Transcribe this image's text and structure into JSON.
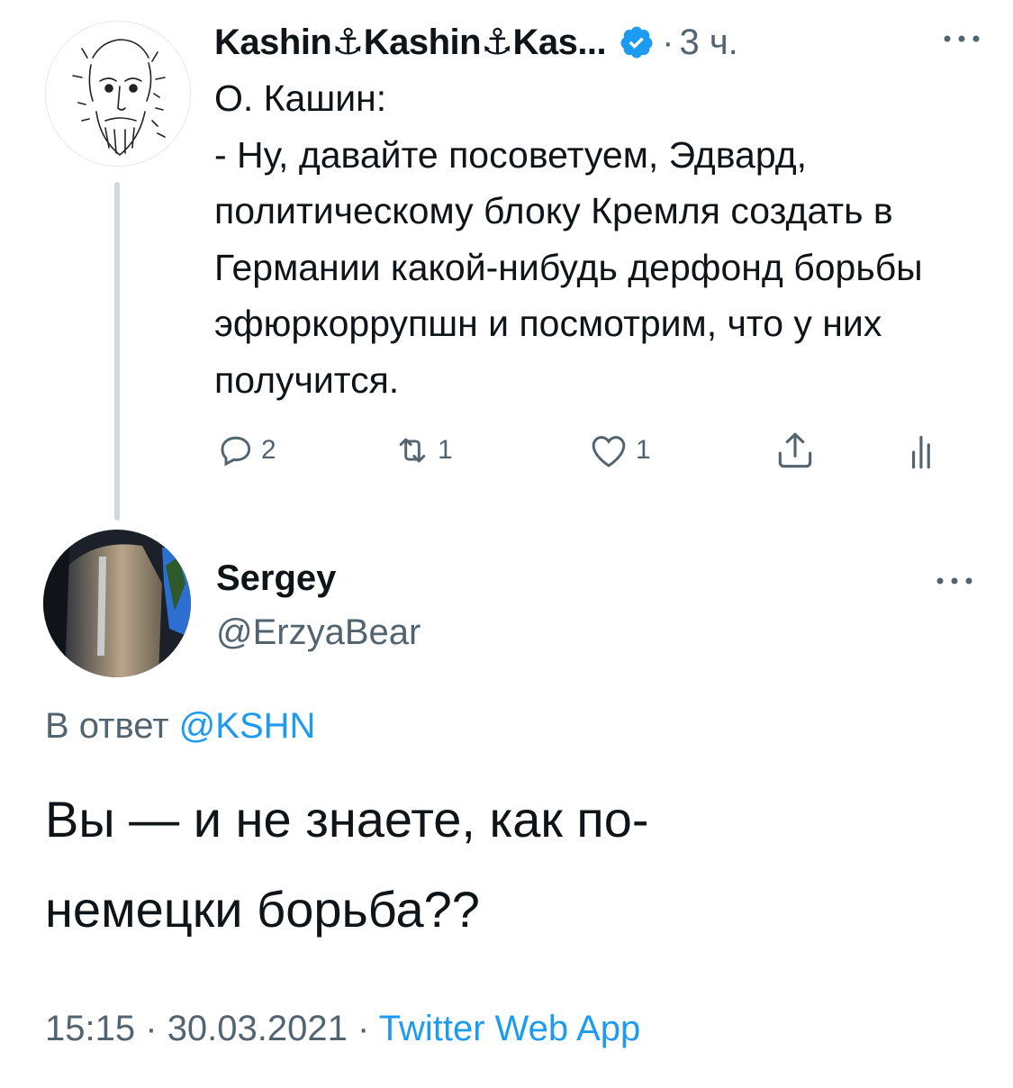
{
  "parent_tweet": {
    "author_name": "Kashin⚓Kashin⚓Kas...",
    "verified": true,
    "separator": "·",
    "time_ago": "3 ч.",
    "text": "О. Кашин:\n- Ну, давайте посоветуем, Эдвард, политическому блоку Кремля создать в Германии какой-нибудь дерфонд борьбы эфюркоррупшн и посмотрим, что у них получится.",
    "actions": {
      "replies": "2",
      "retweets": "1",
      "likes": "1"
    }
  },
  "reply_tweet": {
    "author_name": "Sergey",
    "handle": "@ErzyaBear",
    "reply_label": "В ответ",
    "reply_mention": "@KSHN",
    "text": "Вы — и не знаете, как по-\nнемецки борьба??",
    "time": "15:15",
    "date": "30.03.2021",
    "source": "Twitter Web App",
    "meta_separator": "·"
  },
  "colors": {
    "text_primary": "#0f1419",
    "text_secondary": "#536471",
    "link": "#1d9bf0",
    "thread_line": "#cfd9de"
  },
  "icons": [
    "verified-badge-icon",
    "more-icon",
    "reply-icon",
    "retweet-icon",
    "like-icon",
    "share-icon",
    "analytics-icon"
  ]
}
